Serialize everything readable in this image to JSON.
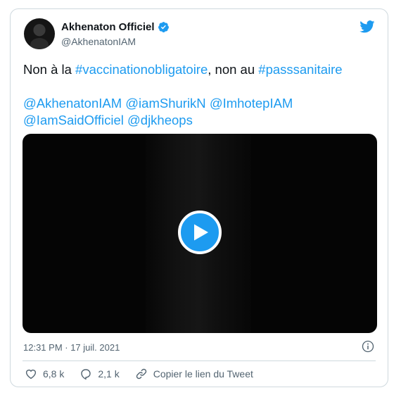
{
  "author": {
    "display_name": "Akhenaton Officiel",
    "handle": "@AkhenatonIAM"
  },
  "tweet": {
    "intro_part1": "Non à la ",
    "hashtag1": "#vaccinationobligatoire",
    "intro_part2": ", non au ",
    "hashtag2": "#passsanitaire",
    "mentions": [
      "@AkhenatonIAM",
      "@iamShurikN",
      "@ImhotepIAM",
      "@IamSaidOfficiel",
      "@djkheops"
    ]
  },
  "meta": {
    "timestamp": "12:31 PM · 17 juil. 2021"
  },
  "actions": {
    "likes": "6,8 k",
    "replies": "2,1 k",
    "copy_link": "Copier le lien du Tweet"
  },
  "icons": {
    "verified": "verified-badge-icon",
    "brand": "twitter-bird-icon",
    "play": "play-icon",
    "info": "info-icon",
    "like": "heart-icon",
    "reply": "reply-bubble-icon",
    "copy_link": "link-icon"
  },
  "colors": {
    "accent": "#1d9bf0",
    "text": "#0f1419",
    "secondary_text": "#536471",
    "border": "#cfd9de",
    "video_bg": "#050505"
  }
}
